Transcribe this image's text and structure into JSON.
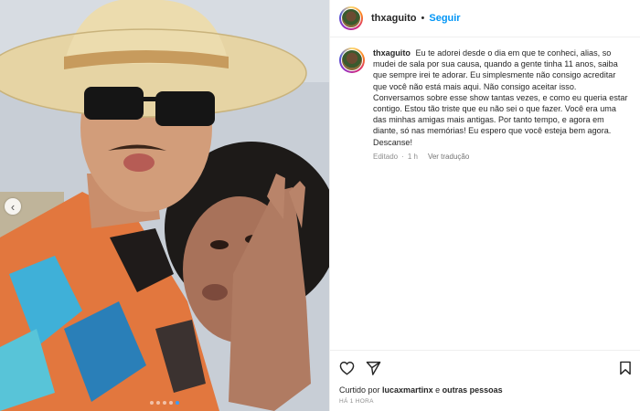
{
  "post": {
    "username": "thxaguito",
    "separator": "•",
    "follow_label": "Seguir",
    "more_label": "···",
    "caption_user": "thxaguito",
    "caption_text": "Eu te adorei desde o dia em que te conheci, alias, so mudei de sala por sua causa, quando a gente tinha 11 anos, saiba que sempre irei te adorar. Eu simplesmente não consigo acreditar que você não está mais aqui. Não consigo aceitar isso. Conversamos sobre esse show tantas vezes, e como eu queria estar contigo. Estou tão triste que eu não sei o que fazer. Você era uma das minhas amigas mais antigas. Por tanto tempo, e agora em diante, só nas memórias! Eu espero que você esteja bem agora. Descanse!",
    "edited_label": "Editado",
    "meta_dot": "·",
    "age": "1 h",
    "translate_label": "Ver tradução",
    "likes_prefix": "Curtido por",
    "likes_user": "lucaxmartinx",
    "likes_conj": "e",
    "likes_others": "outras pessoas",
    "timestamp": "HÁ 1 HORA"
  },
  "carousel": {
    "prev_icon": "‹",
    "slides": 5,
    "active_index": 4
  },
  "colors": {
    "accent": "#0095f6",
    "text": "#262626",
    "muted": "#8e8e8e"
  },
  "icons": {
    "heart": "heart-icon",
    "share": "paper-plane-icon",
    "save": "bookmark-icon"
  }
}
